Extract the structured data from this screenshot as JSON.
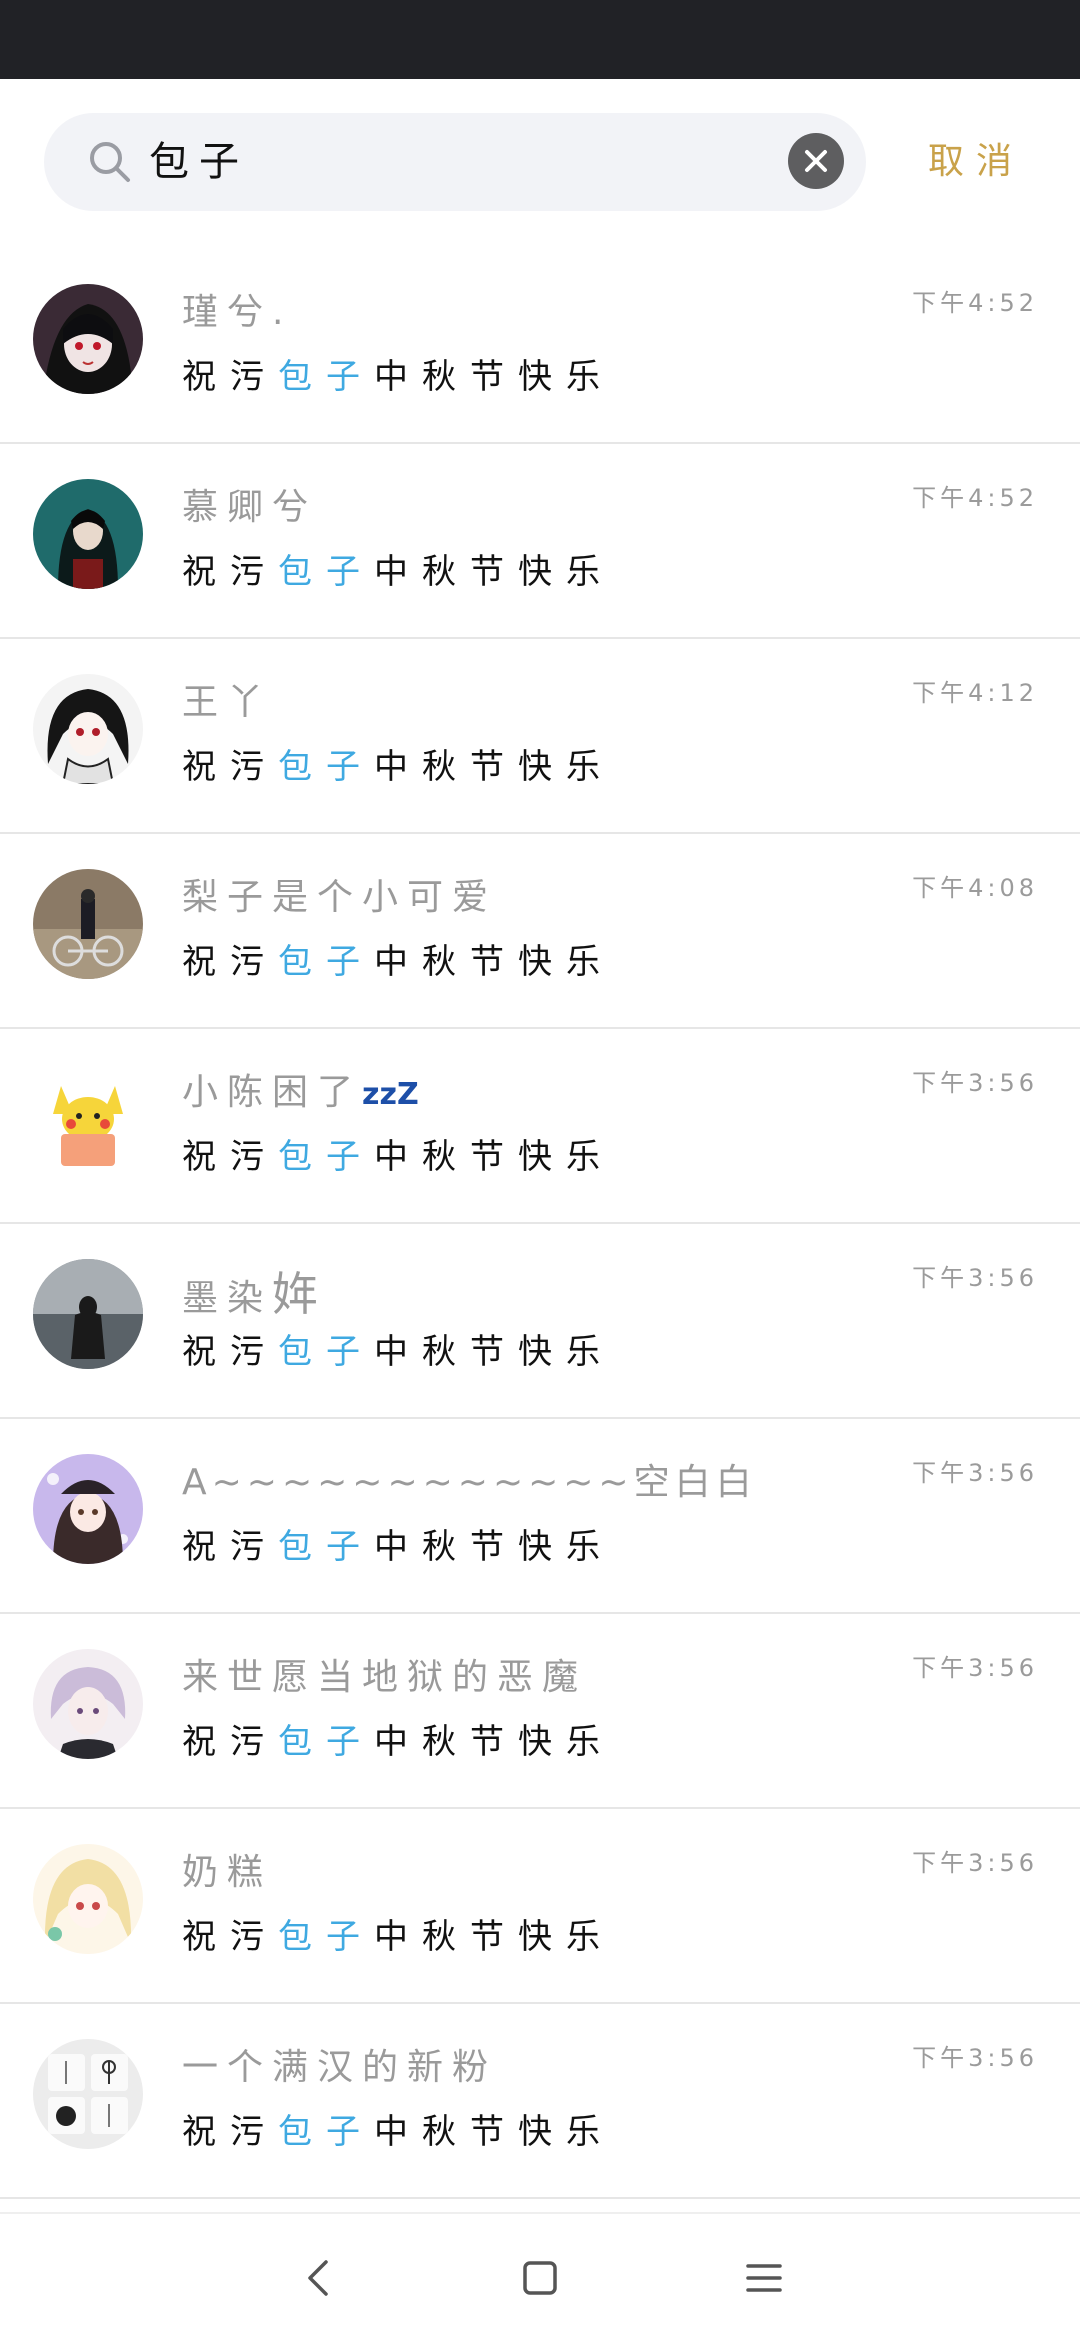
{
  "search": {
    "query": "包子",
    "cancel_label": "取消"
  },
  "results": [
    {
      "name": "瑾兮.",
      "time": "下午4:52",
      "message_pre": "祝污",
      "message_hl": "包子",
      "message_post": "中秋节快乐",
      "avatar": "gothic-girl-avatar"
    },
    {
      "name": "慕卿兮",
      "time": "下午4:52",
      "message_pre": "祝污",
      "message_hl": "包子",
      "message_post": "中秋节快乐",
      "avatar": "hanfu-woman-avatar"
    },
    {
      "name": "王丫",
      "time": "下午4:12",
      "message_pre": "祝污",
      "message_hl": "包子",
      "message_post": "中秋节快乐",
      "avatar": "manga-girl-avatar"
    },
    {
      "name": "梨子是个小可爱",
      "time": "下午4:08",
      "message_pre": "祝污",
      "message_hl": "包子",
      "message_post": "中秋节快乐",
      "avatar": "bicycle-girl-avatar"
    },
    {
      "name": "小陈困了",
      "name_suffix": "zzZ",
      "time": "下午3:56",
      "message_pre": "祝污",
      "message_hl": "包子",
      "message_post": "中秋节快乐",
      "avatar": "pikachu-avatar"
    },
    {
      "name": "墨染",
      "name_suffix": "姩",
      "time": "下午3:56",
      "message_pre": "祝污",
      "message_hl": "包子",
      "message_post": "中秋节快乐",
      "avatar": "sea-girl-avatar"
    },
    {
      "name": "A~~~~~~~~~~~~空白白",
      "time": "下午3:56",
      "message_pre": "祝污",
      "message_hl": "包子",
      "message_post": "中秋节快乐",
      "avatar": "hat-girl-avatar"
    },
    {
      "name": "来世愿当地狱的恶魔",
      "time": "下午3:56",
      "message_pre": "祝污",
      "message_hl": "包子",
      "message_post": "中秋节快乐",
      "avatar": "silver-hair-avatar"
    },
    {
      "name": "奶糕",
      "time": "下午3:56",
      "message_pre": "祝污",
      "message_hl": "包子",
      "message_post": "中秋节快乐",
      "avatar": "blonde-girl-avatar"
    },
    {
      "name": "一个满汉的新粉",
      "time": "下午3:56",
      "message_pre": "祝污",
      "message_hl": "包子",
      "message_post": "中秋节快乐",
      "avatar": "tree-tiles-avatar"
    }
  ],
  "colors": {
    "highlight": "#3fa9e1",
    "cancel": "#c9a24a",
    "status_bar": "#212226"
  },
  "nav": {
    "back_icon": "back-icon",
    "home_icon": "home-icon",
    "menu_icon": "menu-icon"
  }
}
